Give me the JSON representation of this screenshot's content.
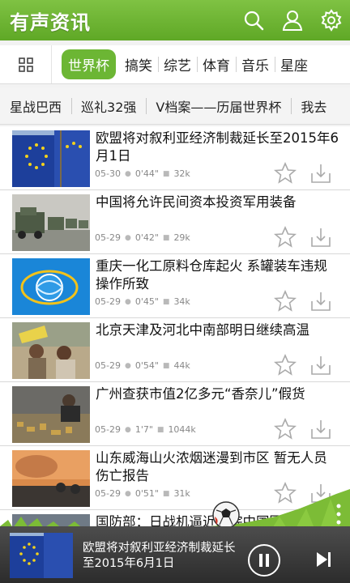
{
  "header": {
    "title": "有声资讯"
  },
  "tabs": [
    "世界杯",
    "搞笑",
    "综艺",
    "体育",
    "音乐",
    "星座"
  ],
  "topics": [
    "星战巴西",
    "巡礼32强",
    "V档案——历届世界杯",
    "我去"
  ],
  "news": [
    {
      "title": "欧盟将对叙利亚经济制裁延长至2015年6月1日",
      "date": "05-30",
      "duration": "0'44\"",
      "size": "32k"
    },
    {
      "title": "中国将允许民间资本投资军用装备",
      "date": "05-29",
      "duration": "0'42\"",
      "size": "29k"
    },
    {
      "title": "重庆一化工原料仓库起火 系罐装车违规操作所致",
      "date": "05-29",
      "duration": "0'45\"",
      "size": "34k"
    },
    {
      "title": "北京天津及河北中南部明日继续高温",
      "date": "05-29",
      "duration": "0'54\"",
      "size": "44k"
    },
    {
      "title": "广州查获市值2亿多元“香奈儿”假货",
      "date": "05-29",
      "duration": "1'7\"",
      "size": "1044k"
    },
    {
      "title": "山东威海山火浓烟迷漫到市区 暂无人员伤亡报告",
      "date": "05-29",
      "duration": "0'51\"",
      "size": "31k"
    },
    {
      "title": "国防部：日战机逼近跟踪中国军机",
      "date": "",
      "duration": "",
      "size": ""
    }
  ],
  "player": {
    "title": "欧盟将对叙利亚经济制裁延长至2015年6月1日"
  },
  "colors": {
    "brand_green": "#6cb634",
    "header_green": "#5fa826",
    "player_bg": "#2c2c2c"
  }
}
